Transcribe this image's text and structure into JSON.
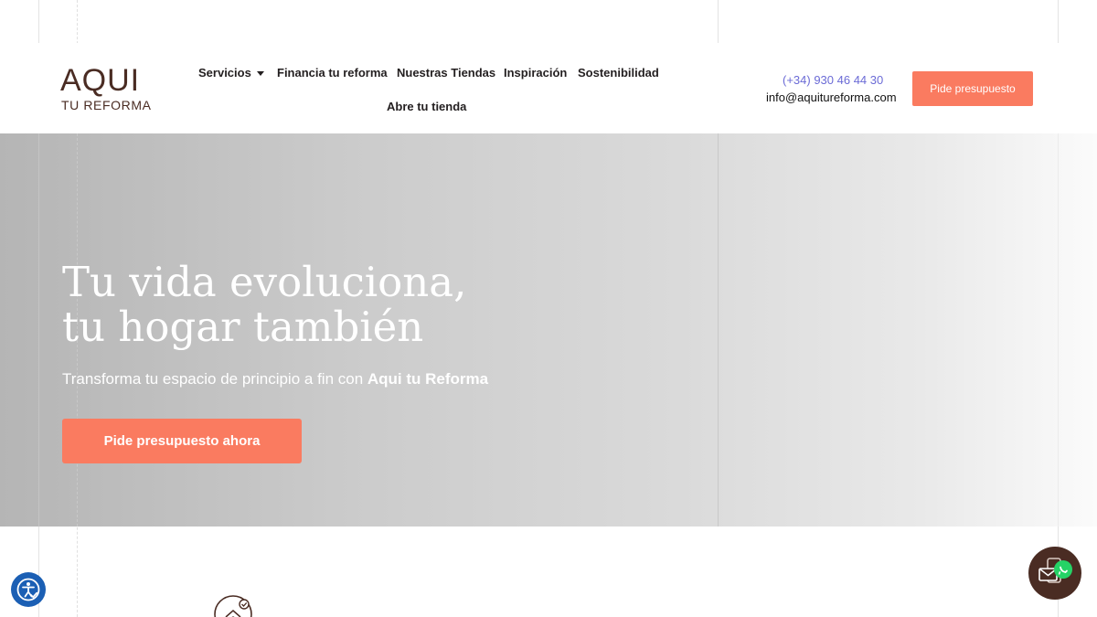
{
  "brand": {
    "logo_main": "AQUI",
    "logo_sub": "TU REFORMA"
  },
  "nav": {
    "items": [
      {
        "label": "Servicios",
        "has_dropdown": true
      },
      {
        "label": "Financia tu reforma"
      },
      {
        "label": "Nuestras Tiendas"
      },
      {
        "label": "Inspiración"
      },
      {
        "label": "Sostenibilidad"
      },
      {
        "label": "Abre tu tienda"
      }
    ],
    "dropdown_icon": "chevron-down-icon"
  },
  "contact": {
    "phone": "(+34) 930 46 44 30",
    "email": "info@aquitureforma.com"
  },
  "header_cta": {
    "label": "Pide presupuesto"
  },
  "hero": {
    "title_line1": "Tu vida evoluciona,",
    "title_line2": "tu hogar también",
    "subtitle_prefix": "Transforma tu espacio de principio a fin con ",
    "subtitle_brand": "Aqui tu Reforma",
    "cta_label": "Pide presupuesto ahora"
  },
  "widgets": {
    "accessibility_icon": "accessibility-icon",
    "contact_icons": [
      "mail-icon",
      "whatsapp-icon"
    ]
  },
  "colors": {
    "accent": "#fa7b60",
    "brand_brown": "#4a2c23",
    "phone_link": "#6b6bd6",
    "accessibility": "#1b5fb4",
    "whatsapp": "#25d366"
  }
}
